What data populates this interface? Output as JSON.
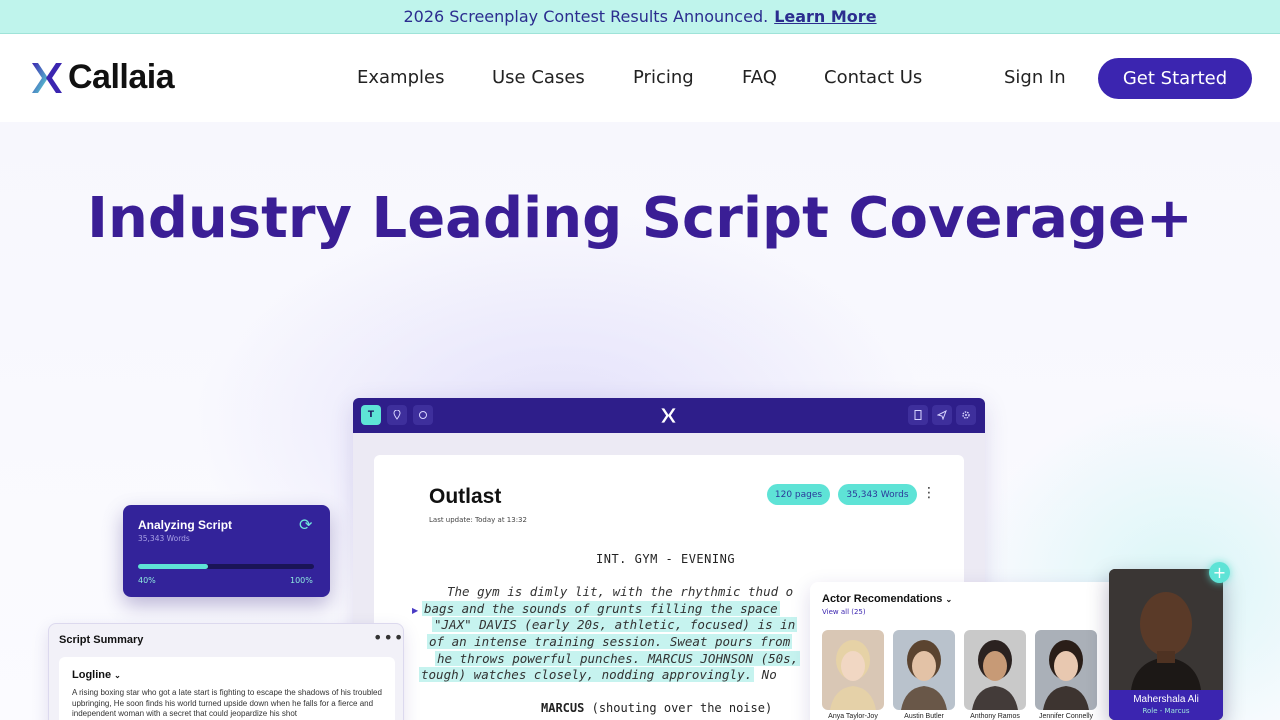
{
  "banner": {
    "text": "2026 Screenplay Contest Results Announced.",
    "link": "Learn More"
  },
  "brand": {
    "name": "Callaia",
    "accent": "#3b25b0",
    "teal": "#5ee3d6",
    "heading_color": "#3a1e95"
  },
  "nav": {
    "links": [
      "Examples",
      "Use Cases",
      "Pricing",
      "FAQ",
      "Contact Us"
    ],
    "sign_in": "Sign In",
    "cta": "Get Started"
  },
  "hero": {
    "title": "Industry Leading Script Coverage+"
  },
  "app": {
    "toolbar": {
      "left_icons": [
        "text-tool-icon",
        "pin-icon",
        "comment-icon"
      ],
      "right_icons": [
        "document-icon",
        "send-icon",
        "settings-icon"
      ]
    },
    "doc": {
      "title": "Outlast",
      "last_update": "Last update: Today at 13:32",
      "pages": "120 pages",
      "words": "35,343 Words",
      "scene_heading": "INT. GYM - EVENING",
      "lines": [
        "The gym is dimly lit, with the rhythmic thud o",
        "bags and the sounds of grunts filling the space",
        "\"JAX\" DAVIS (early 20s, athletic, focused) is in",
        "of an intense training session. Sweat pours from",
        "he throws powerful punches. MARCUS JOHNSON (50s,",
        "tough) watches closely, nodding approvingly."
      ],
      "line_tail": "No",
      "character": "MARCUS",
      "parenthetical": "(shouting over the noise)"
    }
  },
  "analyzing": {
    "title": "Analyzing Script",
    "words": "35,343 Words",
    "progress": 0.4,
    "progress_label": "40%",
    "max_label": "100%"
  },
  "summary": {
    "title": "Script Summary",
    "logline_label": "Logline",
    "logline": "A rising boxing star who got a late start is fighting to escape the shadows of his troubled upbringing, He soon finds his world turned upside down when he falls for a fierce and independent woman with a secret that could jeopardize his shot"
  },
  "actors": {
    "title": "Actor Recomendations",
    "view_all": "View all (25)",
    "list": [
      {
        "name": "Anya Taylor-Joy",
        "bg": "#d9c7b5",
        "skin": "#f1d7c3",
        "hair": "#e6d2a6"
      },
      {
        "name": "Austin Butler",
        "bg": "#b9c2cc",
        "skin": "#e3c2a6",
        "hair": "#5b4430"
      },
      {
        "name": "Anthony Ramos",
        "bg": "#c9c9c9",
        "skin": "#c79a76",
        "hair": "#2b2220"
      },
      {
        "name": "Jennifer Connelly",
        "bg": "#aab0b8",
        "skin": "#e8c8b0",
        "hair": "#2a1e18"
      }
    ],
    "featured": {
      "name": "Mahershala Ali",
      "role": "Role - Marcus"
    }
  }
}
